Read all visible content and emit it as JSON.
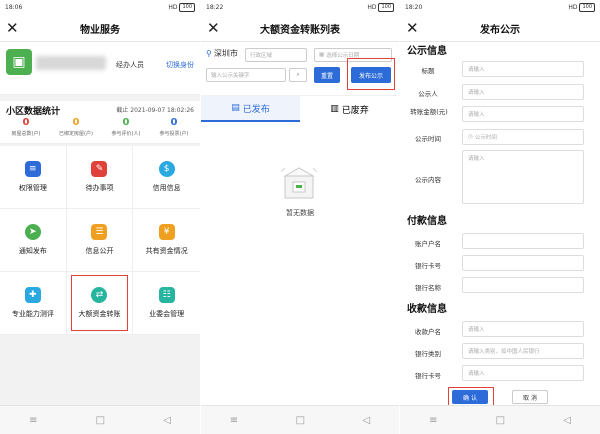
{
  "panel1": {
    "status": {
      "time": "18:06",
      "right": "HD",
      "battery": "100"
    },
    "title": "物业服务",
    "role": "经办人员",
    "switch_label": "切换身份",
    "stats": {
      "title": "小区数据统计",
      "date": "截止 2021-09-07 18:02:26",
      "items": [
        {
          "value": "0",
          "label": "房屋总数(户)",
          "color": "#e0413a"
        },
        {
          "value": "0",
          "label": "已绑定房屋(户)",
          "color": "#f0a020"
        },
        {
          "value": "0",
          "label": "参与评价(人)",
          "color": "#4caf50"
        },
        {
          "value": "0",
          "label": "参与投票(户)",
          "color": "#2d6cd8"
        }
      ]
    },
    "grid": [
      {
        "label": "权限管理",
        "icon": "person-badge-icon",
        "color": "#2d6cd8",
        "glyph": "≡"
      },
      {
        "label": "待办事项",
        "icon": "todo-list-icon",
        "color": "#e0413a",
        "glyph": "✎"
      },
      {
        "label": "信用信息",
        "icon": "credit-icon",
        "color": "#2aa8e0",
        "glyph": "$"
      },
      {
        "label": "通知发布",
        "icon": "send-icon",
        "color": "#4caf50",
        "glyph": "➤"
      },
      {
        "label": "信息公开",
        "icon": "info-public-icon",
        "color": "#f0a020",
        "glyph": "☰"
      },
      {
        "label": "共有资金情况",
        "icon": "fund-icon",
        "color": "#f0a020",
        "glyph": "¥"
      },
      {
        "label": "专业能力测评",
        "icon": "evaluation-icon",
        "color": "#2aa8e0",
        "glyph": "✚"
      },
      {
        "label": "大额资金转账",
        "icon": "transfer-icon",
        "color": "#27b5a0",
        "glyph": "⇄"
      },
      {
        "label": "业委会管理",
        "icon": "committee-icon",
        "color": "#27b5a0",
        "glyph": "☷"
      }
    ]
  },
  "panel2": {
    "status": {
      "time": "18:22",
      "right": "HD",
      "battery": "100"
    },
    "title": "大额资金转账列表",
    "city": "深圳市",
    "district_placeholder": "行政区域",
    "date_placeholder": "选择公示日期",
    "search_placeholder": "输入公示关键字",
    "reset_label": "重置",
    "publish_label": "发布公示",
    "tabs": [
      "已发布",
      "已废弃"
    ],
    "empty_text": "暂无数据"
  },
  "panel3": {
    "status": {
      "time": "18:20",
      "right": "HD",
      "battery": "100"
    },
    "title": "发布公示",
    "sections": {
      "notice": "公示信息",
      "payer": "付款信息",
      "payee": "收款信息"
    },
    "notice_fields": [
      {
        "label": "标题",
        "placeholder": "请输入"
      },
      {
        "label": "公示人",
        "placeholder": "请输入"
      },
      {
        "label": "转账金额(元)",
        "placeholder": "请输入"
      },
      {
        "label": "公示时间",
        "placeholder": "公示时间"
      },
      {
        "label": "公示内容",
        "placeholder": "请输入"
      }
    ],
    "payer_fields": [
      {
        "label": "账户户名",
        "placeholder": ""
      },
      {
        "label": "银行卡号",
        "placeholder": ""
      },
      {
        "label": "银行名称",
        "placeholder": ""
      }
    ],
    "payee_fields": [
      {
        "label": "收款户名",
        "placeholder": "请输入"
      },
      {
        "label": "银行类别",
        "placeholder": "请输入类别，如中国人民银行"
      },
      {
        "label": "银行卡号",
        "placeholder": "请输入"
      }
    ],
    "confirm_label": "确 认",
    "cancel_label": "取 消"
  }
}
